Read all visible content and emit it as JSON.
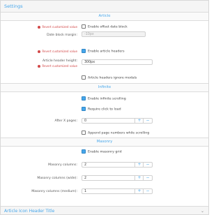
{
  "header": {
    "title": "Settings"
  },
  "sections": {
    "article": "Article",
    "infinite": "Infinite",
    "masonry": "Masonry"
  },
  "article": {
    "revert_label": "Revert customized value",
    "offset_checkbox": "Enable offset date block",
    "date_margin_label": "Date block margin:",
    "date_margin_placeholder": "-10px",
    "headers_checkbox": "Enable article headers",
    "header_height_label": "Article header height:",
    "header_height_value": "300px",
    "ignore_modals_checkbox": "Article headers ignore modals"
  },
  "infinite": {
    "enable_checkbox": "Enable infinite scrolling",
    "require_click_checkbox": "Require click to load",
    "after_pages_label": "After X pages:",
    "after_pages_value": "0",
    "append_numbers_checkbox": "Append page numbers while scrolling"
  },
  "masonry": {
    "enable_checkbox": "Enable masonry grid",
    "columns_label": "Masonry columns:",
    "columns_value": "2",
    "columns_wide_label": "Masonry columns (wide):",
    "columns_wide_value": "2",
    "columns_medium_label": "Masonry columns (medium):",
    "columns_medium_value": "1"
  },
  "stepper": {
    "plus": "+",
    "minus": "−"
  },
  "bottom": {
    "title": "Article Icon Header Title",
    "chevron": "⌄"
  },
  "colors": {
    "accent": "#47a7eb",
    "revert": "#d24848"
  },
  "icons": {
    "revert": "revert-icon",
    "checkbox": "checkbox-icon"
  }
}
